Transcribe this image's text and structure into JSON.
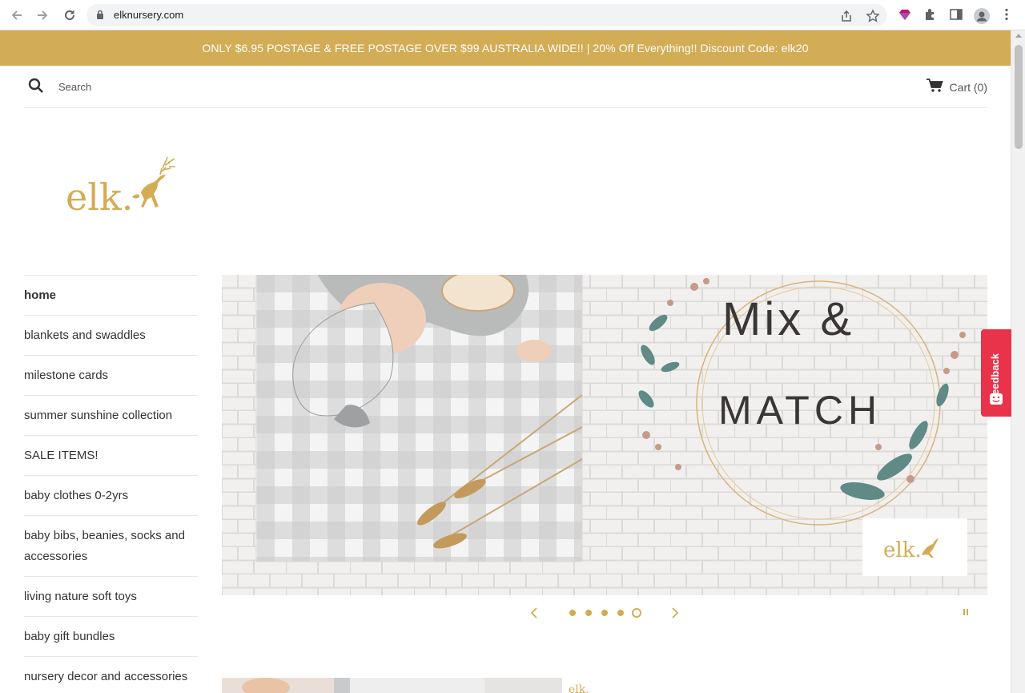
{
  "browser": {
    "url": "elknursery.com"
  },
  "announcement": {
    "text": "ONLY $6.95 POSTAGE & FREE POSTAGE OVER $99 AUSTRALIA WIDE!! | 20% Off Everything!! Discount Code: elk20"
  },
  "header": {
    "search_label": "Search",
    "cart_label": "Cart (0)"
  },
  "logo": {
    "text": "elk."
  },
  "sidebar": {
    "items": [
      {
        "label": "home",
        "active": true
      },
      {
        "label": "blankets and swaddles"
      },
      {
        "label": "milestone cards"
      },
      {
        "label": "summer sunshine collection"
      },
      {
        "label": "SALE ITEMS!"
      },
      {
        "label": "baby clothes 0-2yrs"
      },
      {
        "label": "baby bibs, beanies, socks and accessories"
      },
      {
        "label": "living nature soft toys"
      },
      {
        "label": "baby gift bundles"
      },
      {
        "label": "nursery decor and accessories"
      }
    ]
  },
  "hero": {
    "line1": "Mix &",
    "line2": "MATCH",
    "badge_text": "elk.",
    "slide_count": 5,
    "active_slide": 5
  },
  "feedback": {
    "label": "Feedback"
  },
  "colors": {
    "brand_gold": "#d3ac56",
    "feedback_red": "#e8334a"
  }
}
